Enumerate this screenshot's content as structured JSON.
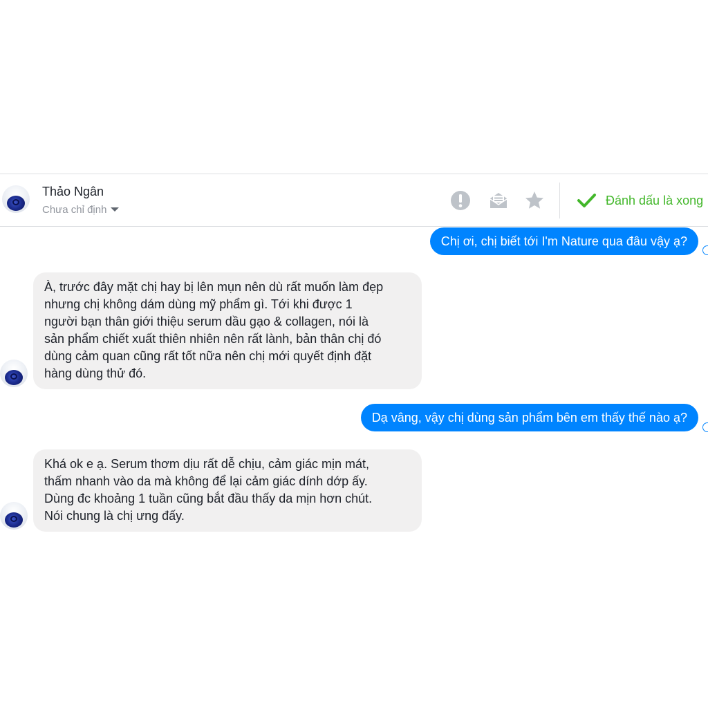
{
  "conversation": {
    "contact": {
      "name": "Thảo Ngân",
      "assignment": "Chưa chỉ định"
    },
    "actions": {
      "spam_icon": "exclamation-circle-icon",
      "unread_icon": "envelope-open-icon",
      "star_icon": "star-icon",
      "mark_done_label": "Đánh dấu là xong"
    }
  },
  "messages": [
    {
      "direction": "outgoing",
      "text": "Chị ơi, chị biết tới I'm Nature qua đâu vậy ạ?"
    },
    {
      "direction": "incoming",
      "lines": [
        "À, trước đây mặt chị hay bị lên mụn nên dù rất muốn làm đẹp",
        "nhưng chị không dám dùng mỹ phẩm gì. Tới khi được 1",
        "người bạn thân giới thiệu serum dầu gạo & collagen, nói là",
        "sản phẩm chiết xuất thiên nhiên nên rất lành, bản thân chị đó",
        "dùng cảm quan cũng rất tốt nữa nên chị mới quyết định đặt",
        "hàng dùng thử đó."
      ]
    },
    {
      "direction": "outgoing",
      "text": "Dạ vâng, vậy chị dùng sản phẩm bên em thấy thế nào ạ?"
    },
    {
      "direction": "incoming",
      "lines": [
        "Khá ok e ạ. Serum thơm dịu rất dễ chịu, cảm giác mịn mát,",
        "thấm nhanh vào da mà không để lại cảm giác dính dớp ấy.",
        "Dùng đc khoảng 1 tuần cũng bắt đầu thấy da mịn hơn chút.",
        "Nói chung là chị ưng đấy."
      ]
    }
  ],
  "colors": {
    "outgoing_bubble": "#0084ff",
    "incoming_bubble": "#f1f0f0",
    "done_green": "#42b72a",
    "icon_gray": "#bec3c9"
  }
}
